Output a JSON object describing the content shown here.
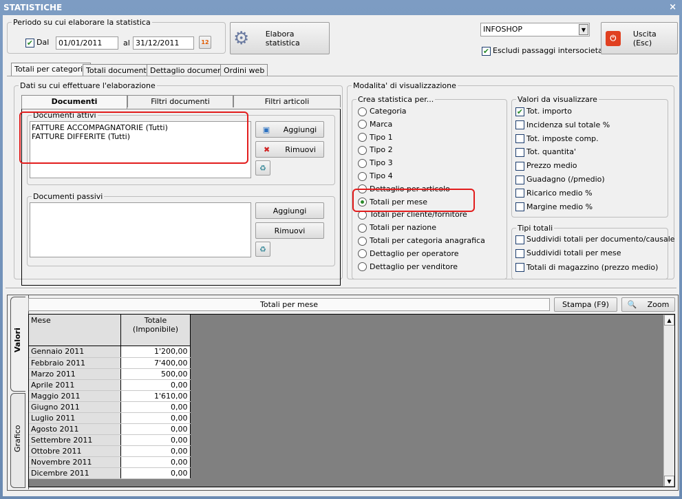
{
  "window": {
    "title": "STATISTICHE",
    "close": "×"
  },
  "period": {
    "legend": "Periodo su cui elaborare la statistica",
    "dal_label": "Dal",
    "dal_checked": true,
    "from": "01/01/2011",
    "al_label": "al",
    "to": "31/12/2011"
  },
  "elabora_label": "Elabora statistica",
  "company": {
    "value": "INFOSHOP",
    "escludi_label": "Escludi passaggi intersocietari",
    "escludi_checked": true
  },
  "uscita_label": "Uscita (Esc)",
  "main_tabs": [
    "Totali per categoria",
    "Totali documenti",
    "Dettaglio documenti",
    "Ordini web"
  ],
  "dati": {
    "legend": "Dati su cui effettuare l'elaborazione",
    "tabs": [
      "Documenti",
      "Filtri documenti",
      "Filtri articoli"
    ],
    "attivi": {
      "legend": "Documenti attivi",
      "items": [
        "FATTURE ACCOMPAGNATORIE (Tutti)",
        "FATTURE DIFFERITE (Tutti)"
      ],
      "add": "Aggiungi",
      "remove": "Rimuovi"
    },
    "passivi": {
      "legend": "Documenti passivi",
      "items": [],
      "add": "Aggiungi",
      "remove": "Rimuovi"
    }
  },
  "modalita": {
    "legend": "Modalita' di visualizzazione",
    "crea": {
      "legend": "Crea statistica per...",
      "options": [
        "Categoria",
        "Marca",
        "Tipo 1",
        "Tipo 2",
        "Tipo 3",
        "Tipo 4",
        "Dettaglio per articolo",
        "Totali per mese",
        "Totali per cliente/fornitore",
        "Totali per nazione",
        "Totali per categoria anagrafica",
        "Dettaglio per operatore",
        "Dettaglio per venditore"
      ],
      "selected": "Totali per mese"
    },
    "valori": {
      "legend": "Valori da visualizzare",
      "items": [
        {
          "label": "Tot. importo",
          "checked": true
        },
        {
          "label": "Incidenza sul totale %",
          "checked": false
        },
        {
          "label": "Tot. imposte comp.",
          "checked": false
        },
        {
          "label": "Tot. quantita'",
          "checked": false
        },
        {
          "label": "Prezzo medio",
          "checked": false
        },
        {
          "label": "Guadagno (/pmedio)",
          "checked": false
        },
        {
          "label": "Ricarico medio %",
          "checked": false
        },
        {
          "label": "Margine medio %",
          "checked": false
        }
      ]
    },
    "tipi": {
      "legend": "Tipi totali",
      "items": [
        {
          "label": "Suddividi totali per documento/causale",
          "checked": false
        },
        {
          "label": "Suddividi totali per mese",
          "checked": false
        },
        {
          "label": "Totali di magazzino (prezzo medio)",
          "checked": false
        }
      ]
    }
  },
  "results": {
    "side_tabs": [
      "Valori",
      "Grafico"
    ],
    "title": "Totali per mese",
    "stampa": "Stampa (F9)",
    "zoom": "Zoom",
    "columns": [
      "Mese",
      "Totale\n(Imponibile)"
    ],
    "rows": [
      [
        "Gennaio 2011",
        "1'200,00"
      ],
      [
        "Febbraio 2011",
        "7'400,00"
      ],
      [
        "Marzo 2011",
        "500,00"
      ],
      [
        "Aprile 2011",
        "0,00"
      ],
      [
        "Maggio 2011",
        "1'610,00"
      ],
      [
        "Giugno 2011",
        "0,00"
      ],
      [
        "Luglio 2011",
        "0,00"
      ],
      [
        "Agosto 2011",
        "0,00"
      ],
      [
        "Settembre 2011",
        "0,00"
      ],
      [
        "Ottobre 2011",
        "0,00"
      ],
      [
        "Novembre 2011",
        "0,00"
      ],
      [
        "Dicembre 2011",
        "0,00"
      ]
    ]
  },
  "colors": {
    "highlight": "#e21c1c",
    "titlebar": "#6d8db5",
    "grid_bg": "#808080"
  }
}
